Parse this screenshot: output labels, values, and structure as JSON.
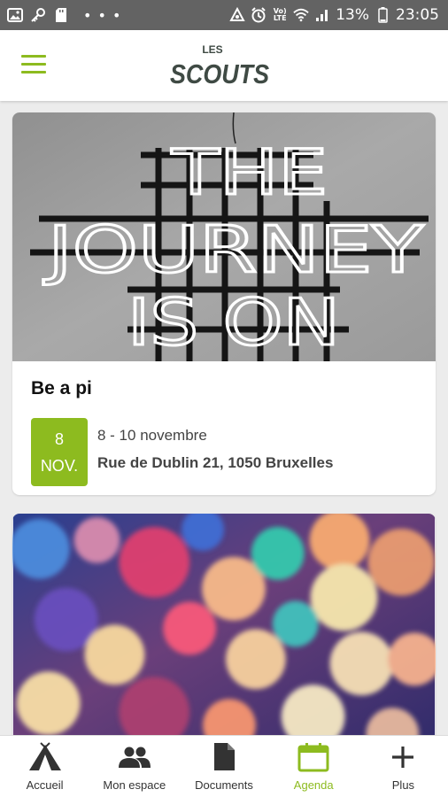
{
  "status_bar": {
    "left_icons": [
      "image-icon",
      "key-icon",
      "sd-card-icon",
      "more-dots-icon"
    ],
    "more_dots": "• • •",
    "right_icons": [
      "recycle-icon",
      "alarm-icon",
      "volte-icon",
      "wifi-icon",
      "signal-icon",
      "battery-icon"
    ],
    "volte_label": "Vo) LTE",
    "battery": "13%",
    "time": "23:05"
  },
  "header": {
    "menu_icon": "hamburger-menu-icon",
    "logo_top": "LES",
    "logo_main": "SCOUTS"
  },
  "events": [
    {
      "image_text": [
        "THE",
        "JOURNEY",
        "IS ON"
      ],
      "title": "Be a pi",
      "badge_day": "8",
      "badge_month": "NOV.",
      "dates": "8 - 10 novembre",
      "location": "Rue de Dublin 21, 1050 Bruxelles"
    }
  ],
  "nav": {
    "items": [
      {
        "label": "Accueil",
        "icon": "tent-icon",
        "active": false
      },
      {
        "label": "Mon espace",
        "icon": "group-icon",
        "active": false
      },
      {
        "label": "Documents",
        "icon": "document-icon",
        "active": false
      },
      {
        "label": "Agenda",
        "icon": "calendar-icon",
        "active": true
      },
      {
        "label": "Plus",
        "icon": "plus-icon",
        "active": false
      }
    ]
  },
  "colors": {
    "accent": "#8dbb1f",
    "logo": "#3f4a44",
    "status_bar": "#636363",
    "background": "#ececec"
  }
}
